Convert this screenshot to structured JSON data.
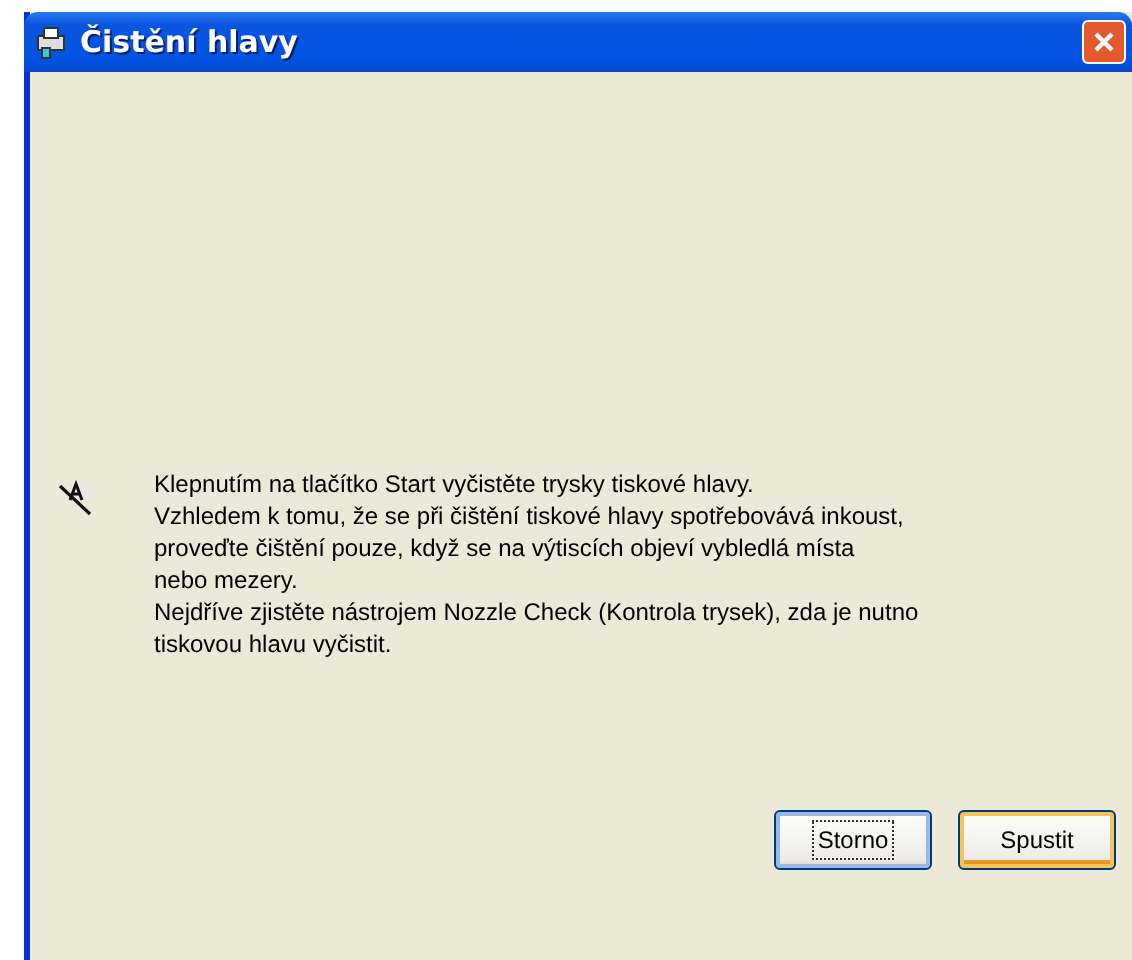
{
  "window": {
    "title": "Čistění hlavy"
  },
  "message": {
    "lines": [
      "Klepnutím na tlačítko Start vyčistěte trysky tiskové hlavy.",
      "Vzhledem k tomu, že se při čištění tiskové hlavy spotřebovává inkoust,",
      "proveďte čištění pouze, když se na výtiscích objeví vybledlá místa",
      "nebo mezery.",
      "Nejdříve zjistěte nástrojem Nozzle Check (Kontrola trysek), zda je nutno",
      "tiskovou hlavu vyčistit."
    ]
  },
  "buttons": [
    {
      "label": "Storno",
      "focused": true,
      "default": false
    },
    {
      "label": "Spustit",
      "focused": false,
      "default": true
    }
  ]
}
